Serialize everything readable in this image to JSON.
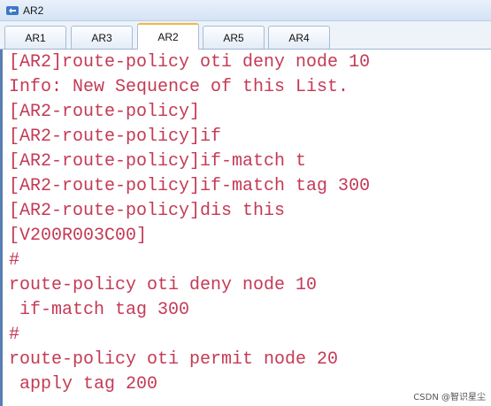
{
  "window": {
    "title": "AR2",
    "icon": "router-icon"
  },
  "tabs": [
    {
      "label": "AR1",
      "active": false
    },
    {
      "label": "AR3",
      "active": false
    },
    {
      "label": "AR2",
      "active": true
    },
    {
      "label": "AR5",
      "active": false
    },
    {
      "label": "AR4",
      "active": false
    }
  ],
  "terminal": {
    "text_color": "#c43a55",
    "lines": [
      "[AR2]route-policy oti deny node 10",
      "Info: New Sequence of this List.",
      "[AR2-route-policy]",
      "[AR2-route-policy]if",
      "[AR2-route-policy]if-match t",
      "[AR2-route-policy]if-match tag 300",
      "[AR2-route-policy]dis this",
      "[V200R003C00]",
      "#",
      "route-policy oti deny node 10",
      " if-match tag 300",
      "#",
      "route-policy oti permit node 20",
      " apply tag 200"
    ]
  },
  "watermark": "CSDN @智识星尘"
}
